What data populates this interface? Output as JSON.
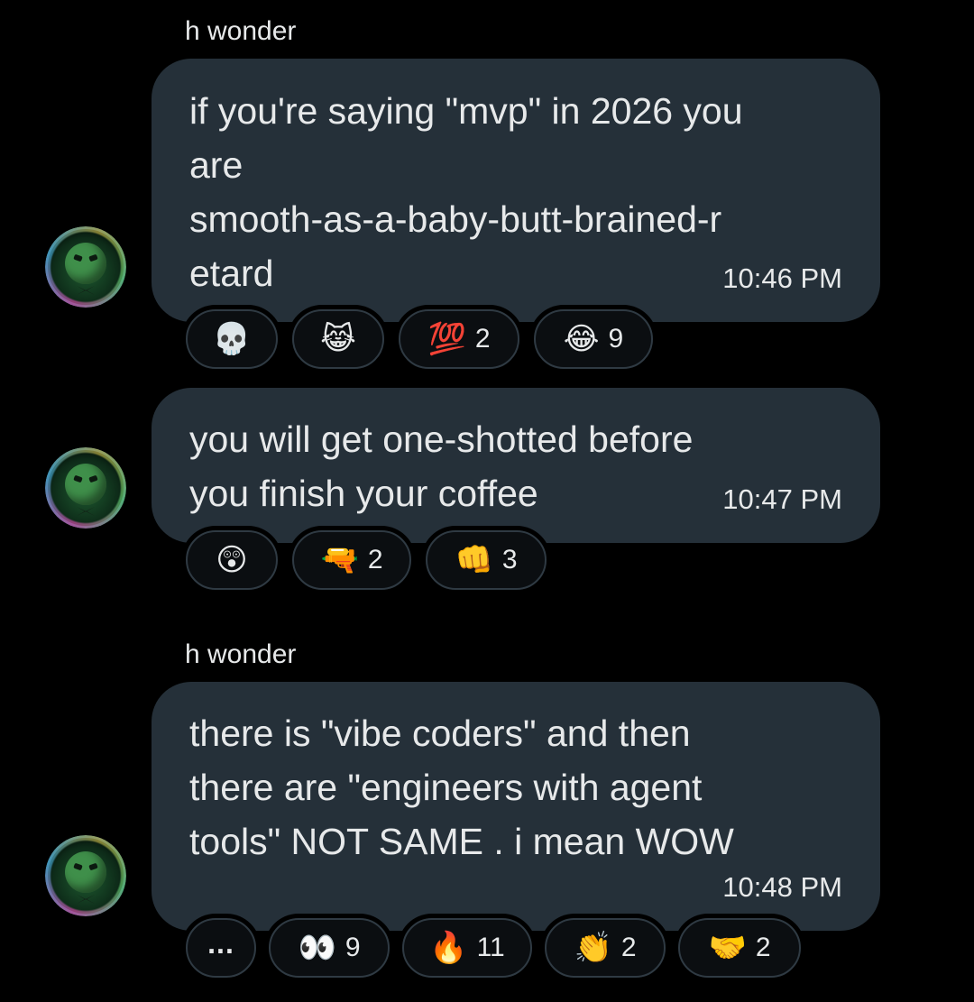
{
  "messages": [
    {
      "sender": "h wonder",
      "text": "if you're saying \"mvp\" in 2026 you\nare\nsmooth-as-a-baby-butt-brained-r\netard",
      "time": "10:46 PM",
      "reactions": [
        {
          "emoji": "💀",
          "name": "skull-emoji",
          "count": ""
        },
        {
          "emoji": "😹",
          "name": "cat-joy-emoji",
          "count": ""
        },
        {
          "emoji": "💯",
          "name": "hundred-points-emoji",
          "count": "2"
        },
        {
          "emoji": "😂",
          "name": "tears-of-joy-emoji",
          "count": "9"
        }
      ]
    },
    {
      "sender": "",
      "text": "you will get one-shotted before\nyou finish your coffee",
      "time": "10:47 PM",
      "reactions": [
        {
          "emoji": "😲",
          "name": "astonished-face-emoji",
          "count": ""
        },
        {
          "emoji": "🔫",
          "name": "water-pistol-emoji",
          "count": "2"
        },
        {
          "emoji": "👊",
          "name": "fist-bump-emoji",
          "count": "3"
        }
      ]
    },
    {
      "sender": "h wonder",
      "text": "there is \"vibe coders\" and then\nthere are \"engineers with agent\ntools\" NOT SAME . i mean WOW",
      "time": "10:48 PM",
      "more_label": "...",
      "reactions": [
        {
          "emoji": "👀",
          "name": "eyes-emoji",
          "count": "9"
        },
        {
          "emoji": "🔥",
          "name": "fire-emoji",
          "count": "11"
        },
        {
          "emoji": "👏",
          "name": "clapping-hands-emoji",
          "count": "2"
        },
        {
          "emoji": "🤝",
          "name": "handshake-emoji",
          "count": "2"
        }
      ]
    }
  ],
  "colors": {
    "background": "#000000",
    "bubble": "#253039",
    "text": "#e7e9ea",
    "chip_background": "#0b0e11",
    "chip_border": "#2f3a43"
  },
  "icons": {
    "avatar": "avatar-icon"
  }
}
